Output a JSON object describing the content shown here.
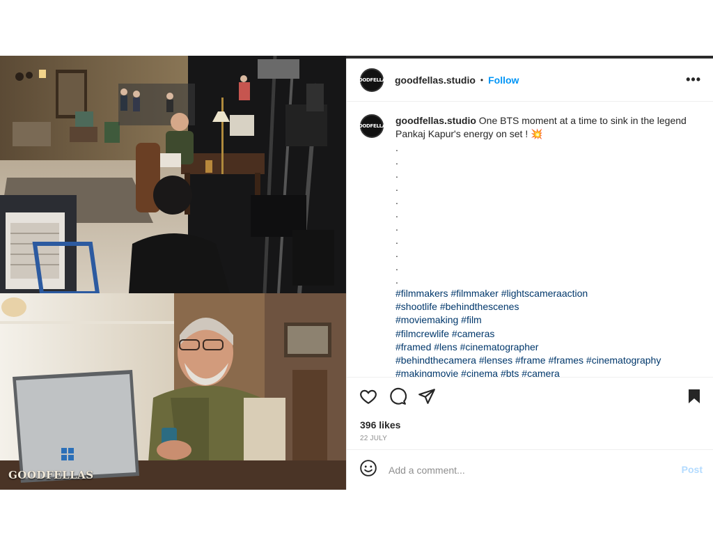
{
  "post": {
    "avatar_text": "GOODFELLAS",
    "username": "goodfellas.studio",
    "separator": "•",
    "follow_label": "Follow",
    "more_label": "•••",
    "watermark": "GOODFELLAS",
    "caption": {
      "username": "goodfellas.studio",
      "text": "One BTS moment at a time to sink in the legend Pankaj Kapur's energy on set ! 💥",
      "dots": [
        ".",
        ".",
        ".",
        ".",
        ".",
        ".",
        ".",
        ".",
        ".",
        ".",
        "."
      ],
      "hashtag_lines": [
        "#filmmakers #filmmaker #lightscameraaction",
        "#shootlife #behindthescenes",
        "#moviemaking #film",
        "#filmcrewlife #cameras",
        "#framed #lens #cinematographer",
        "#behindthecamera #lenses #frame #frames #cinematography",
        "#makingmovie #cinema #bts #camera"
      ]
    },
    "icons": [
      "heart-icon",
      "comment-icon",
      "share-icon",
      "bookmark-icon",
      "emoji-icon",
      "more-icon"
    ],
    "likes": "396 likes",
    "date": "22 JULY",
    "comment": {
      "placeholder": "Add a comment...",
      "post_label": "Post"
    },
    "colors": {
      "follow": "#0095f6",
      "hashtag": "#00376b",
      "post_disabled": "#b3dbff",
      "meta": "#8e8e8e"
    }
  }
}
